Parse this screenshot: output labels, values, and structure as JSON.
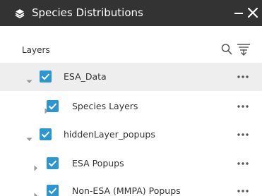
{
  "panel": {
    "title": "Species Distributions",
    "header_bg": "#333333",
    "accent": "#2a96d2"
  },
  "icons": {
    "title": "layers-icon",
    "minimize": "minimize-icon",
    "close": "close-icon",
    "search": "search-icon",
    "filter": "filter-icon",
    "expanded": "caret-down-icon",
    "collapsed": "caret-right-icon",
    "checked": "checkmark-icon",
    "more": "more-options-icon"
  },
  "layers_section": {
    "label": "Layers"
  },
  "layers": [
    {
      "label": "ESA_Data",
      "expanded": true,
      "checked": true,
      "level": 0,
      "highlighted": true
    },
    {
      "label": "Species Layers",
      "expanded": false,
      "checked": true,
      "level": 1,
      "highlighted": false
    },
    {
      "label": "hiddenLayer_popups",
      "expanded": true,
      "checked": true,
      "level": 0,
      "highlighted": false
    },
    {
      "label": "ESA Popups",
      "expanded": false,
      "checked": true,
      "level": 1,
      "highlighted": false
    },
    {
      "label": "Non-ESA (MMPA) Popups",
      "expanded": false,
      "checked": true,
      "level": 1,
      "highlighted": false
    }
  ]
}
